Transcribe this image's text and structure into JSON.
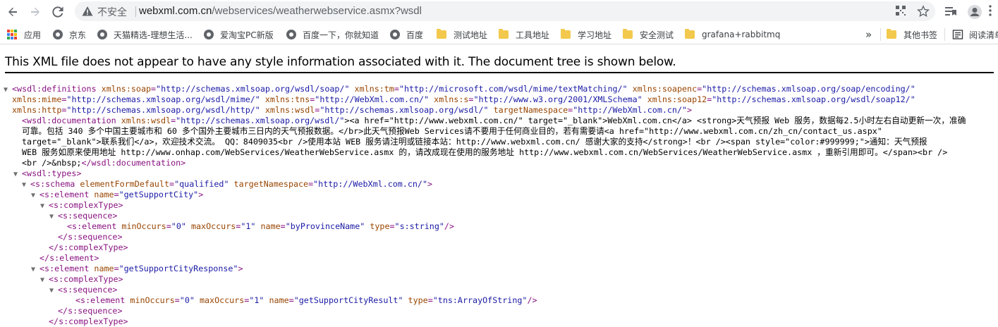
{
  "browser": {
    "security_label": "不安全",
    "url_host": "webxml.com.cn",
    "url_path": "/webservices/weatherwebservice.asmx?wsdl",
    "accent": "#1a73e8",
    "icons": [
      "back-arrow-icon",
      "forward-arrow-icon",
      "reload-icon",
      "warning-icon",
      "qr-code-icon",
      "star-icon",
      "reading-list-icon",
      "profile-icon",
      "menu-dots-icon"
    ]
  },
  "bookmarks": {
    "items": [
      {
        "label": "应用",
        "icon": "apps-grid-icon"
      },
      {
        "label": "京东",
        "icon": "globe-icon"
      },
      {
        "label": "天猫精选-理想生活...",
        "icon": "globe-icon"
      },
      {
        "label": "爱淘宝PC新版",
        "icon": "globe-icon"
      },
      {
        "label": "百度一下，你就知道",
        "icon": "globe-icon"
      },
      {
        "label": "百度",
        "icon": "globe-icon"
      },
      {
        "label": "测试地址",
        "icon": "folder-icon"
      },
      {
        "label": "工具地址",
        "icon": "folder-icon"
      },
      {
        "label": "学习地址",
        "icon": "folder-icon"
      },
      {
        "label": "安全测试",
        "icon": "folder-icon"
      },
      {
        "label": "grafana+rabbitmq",
        "icon": "folder-icon"
      }
    ],
    "overflow": "»",
    "other": "其他书签",
    "reading_list": "阅读清单"
  },
  "page": {
    "notice": "This XML file does not appear to have any style information associated with it. The document tree is shown below."
  },
  "xml": {
    "l1_open": "<wsdl:definitions",
    "l1_a1n": " xmlns:soap",
    "l1_a1v": "\"http://schemas.xmlsoap.org/wsdl/soap/\"",
    "l1_a2n": " xmlns:tm",
    "l1_a2v": "\"http://microsoft.com/wsdl/mime/textMatching/\"",
    "l1_a3n": " xmlns:soapenc",
    "l1_a3v": "\"http://schemas.xmlsoap.org/soap/encoding/\"",
    "l2_a1n": "xmlns:mime",
    "l2_a1v": "\"http://schemas.xmlsoap.org/wsdl/mime/\"",
    "l2_a2n": " xmlns:tns",
    "l2_a2v": "\"http://WebXml.com.cn/\"",
    "l2_a3n": " xmlns:s",
    "l2_a3v": "\"http://www.w3.org/2001/XMLSchema\"",
    "l2_a4n": " xmlns:soap12",
    "l2_a4v": "\"http://schemas.xmlsoap.org/wsdl/soap12/\"",
    "l3_a1n": "xmlns:http",
    "l3_a1v": "\"http://schemas.xmlsoap.org/wsdl/http/\"",
    "l3_a2n": " xmlns:wsdl",
    "l3_a2v": "\"http://schemas.xmlsoap.org/wsdl/\"",
    "l3_a3n": " targetNamespace",
    "l3_a3v": "\"http://WebXml.com.cn/\"",
    "l3_close": ">",
    "doc_open": "<wsdl:documentation",
    "doc_an": " xmlns:wsdl",
    "doc_av": "\"http://schemas.xmlsoap.org/wsdl/\"",
    "doc_t1": ">&lt;a href=\"http://www.webxml.com.cn/\" target=\"_blank\"&gt;WebXml.com.cn&lt;/a&gt; &lt;strong&gt;天气预报 Web 服务，数据每2.5小时左右自动更新一次，准确",
    "doc_t2": "可靠。包括 340 多个中国主要城市和 60 多个国外主要城市三日内的天气预报数据。&lt;/br&gt;此天气预报Web Services请不要用于任何商业目的，若有需要请&lt;a href=\"http://www.webxml.com.cn/zh_cn/contact_us.aspx\"",
    "doc_t3": "target=\"_blank\"&gt;联系我们&lt;/a&gt;，欢迎技术交流。 QQ：8409035&lt;br /&gt;使用本站 WEB 服务请注明或链接本站：http://www.webxml.com.cn/ 感谢大家的支持&lt;/strong&gt;！&lt;br /&gt;&lt;span style=\"color:#999999;\"&gt;通知：天气预报",
    "doc_t4": "WEB 服务如原来使用地址 http://www.onhap.com/WebServices/WeatherWebService.asmx 的，请改成现在使用的服务地址 http://www.webxml.com.cn/WebServices/WeatherWebService.asmx ，重新引用即可。&lt;/span&gt;&lt;br /&gt;",
    "doc_t5": "&lt;br /&gt;&amp;nbsp;",
    "doc_close": "</wsdl:documentation>",
    "types_open": "<wsdl:types>",
    "schema_open": "<s:schema",
    "schema_a1n": " elementFormDefault",
    "schema_a1v": "\"qualified\"",
    "schema_a2n": " targetNamespace",
    "schema_a2v": "\"http://WebXml.com.cn/\"",
    "gt": ">",
    "el_open": "<s:element",
    "name_an": " name",
    "el1_name": "\"getSupportCity\"",
    "ct_open": "<s:complexType>",
    "seq_open": "<s:sequence>",
    "minOccurs_an": " minOccurs",
    "minOccurs_av": "\"0\"",
    "maxOccurs_an": " maxOccurs",
    "maxOccurs_av": "\"1\"",
    "el1_child_name": "\"byProvinceName\"",
    "type_an": " type",
    "el1_child_type": "\"s:string\"",
    "self_close": "/>",
    "seq_close": "</s:sequence>",
    "ct_close": "</s:complexType>",
    "el_close": "</s:element>",
    "el2_name": "\"getSupportCityResponse\"",
    "el2_child_name": "\"getSupportCityResult\"",
    "el2_child_type": "\"tns:ArrayOfString\"",
    "triangle": "▼"
  }
}
